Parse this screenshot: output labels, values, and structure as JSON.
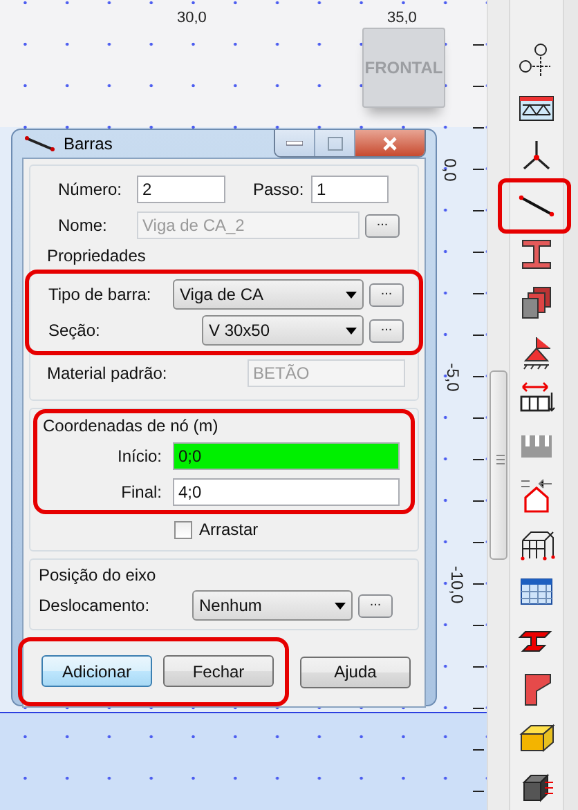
{
  "canvas": {
    "top_labels": [
      "30,0",
      "35,0"
    ],
    "side_labels": [
      "0,0",
      "-5,0",
      "-10,0"
    ],
    "view_cube": {
      "label": "FRONTAL"
    }
  },
  "dialog": {
    "title": "Barras",
    "numero": {
      "label": "Número:",
      "value": "2"
    },
    "passo": {
      "label": "Passo:",
      "value": "1"
    },
    "nome": {
      "label": "Nome:",
      "value": "Viga de CA_2",
      "disabled": true,
      "browse": "..."
    },
    "properties": {
      "title": "Propriedades",
      "highlighted": true,
      "rows": [
        {
          "label": "Tipo de barra:",
          "value": "Viga de CA",
          "browse": "..."
        },
        {
          "label": "Seção:",
          "value": "V 30x50",
          "browse": "..."
        }
      ]
    },
    "material": {
      "label": "Material padrão:",
      "value": "BETÃO",
      "disabled": true
    },
    "coordinates": {
      "title": "Coordenadas de nó (m)",
      "highlighted": true,
      "rows": [
        {
          "label": "Início:",
          "value": "0;0",
          "active": true
        },
        {
          "label": "Final:",
          "value": "4;0",
          "active": false
        }
      ]
    },
    "drag": {
      "label": "Arrastar",
      "checked": false
    },
    "axis": {
      "title": "Posição do eixo",
      "label": "Deslocamento:",
      "value": "Nenhum",
      "browse": "..."
    },
    "buttons": [
      {
        "label": "Adicionar",
        "default": true,
        "highlighted": true
      },
      {
        "label": "Fechar",
        "default": false,
        "highlighted": true
      },
      {
        "label": "Ajuda",
        "default": false,
        "highlighted": false
      }
    ]
  },
  "toolbar": {
    "tools": [
      {
        "kind": "axes",
        "highlighted": false
      },
      {
        "kind": "truss",
        "highlighted": false
      },
      {
        "kind": "node",
        "highlighted": false
      },
      {
        "kind": "bar",
        "highlighted": true
      },
      {
        "kind": "ibeam",
        "highlighted": false
      },
      {
        "kind": "panels",
        "highlighted": false
      },
      {
        "kind": "support",
        "highlighted": false
      },
      {
        "kind": "load",
        "highlighted": false
      },
      {
        "kind": "wall",
        "highlighted": false
      },
      {
        "kind": "house",
        "highlighted": false
      },
      {
        "kind": "frame",
        "highlighted": false
      },
      {
        "kind": "table",
        "highlighted": false
      },
      {
        "kind": "steel",
        "highlighted": false
      },
      {
        "kind": "column",
        "highlighted": false
      },
      {
        "kind": "timber",
        "highlighted": false
      },
      {
        "kind": "block",
        "highlighted": false
      }
    ]
  }
}
